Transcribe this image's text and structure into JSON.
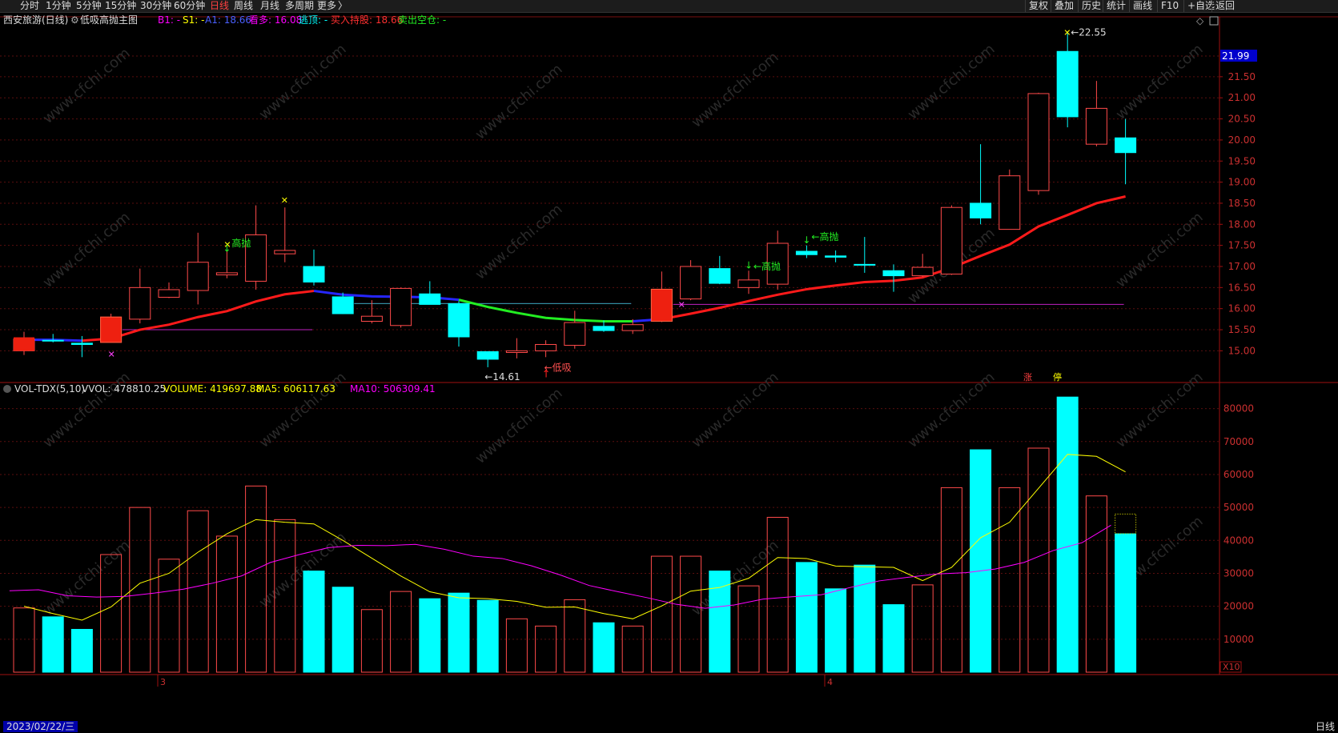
{
  "toolbar": {
    "periods": [
      "分时",
      "1分钟",
      "5分钟",
      "15分钟",
      "30分钟",
      "60分钟",
      "日线",
      "周线",
      "月线",
      "多周期",
      "更多"
    ],
    "active": "日线",
    "right": [
      "复权",
      "叠加",
      "历史",
      "统计",
      "画线",
      "F10",
      "+自选",
      "返回"
    ]
  },
  "header": {
    "stock": "西安旅游(日线)",
    "indicator": "低吸高抛主图",
    "b1": "B1: -",
    "s1": "S1: -",
    "a1": "A1: 18.66",
    "kanduo": "看多: 16.08",
    "taoding": "逃顶: -",
    "mairu": "买入持股: 18.66",
    "maichu": "卖出空仓: -"
  },
  "vol_header": {
    "name": "VOL-TDX(5,10)",
    "vvol": "VVOL: 478810.25",
    "volume": "VOLUME: 419697.88",
    "ma5": "MA5: 606117.63",
    "ma10": "MA10: 506309.41"
  },
  "price_axis": {
    "ticks": [
      "21.50",
      "21.00",
      "20.50",
      "20.00",
      "19.50",
      "19.00",
      "18.50",
      "18.00",
      "17.50",
      "17.00",
      "16.50",
      "16.00",
      "15.50",
      "15.00"
    ],
    "current": "21.99"
  },
  "vol_axis": {
    "ticks": [
      "80000",
      "70000",
      "60000",
      "50000",
      "40000",
      "30000",
      "20000",
      "10000"
    ],
    "unit": "X10"
  },
  "annotations": {
    "high": "22.55",
    "low": "14.61",
    "gaopao": "高抛",
    "dixi": "低吸",
    "zhang": "涨",
    "ting": "停"
  },
  "date_label": "2023/02/22/三",
  "month_labels": [
    "3",
    "4"
  ],
  "period_label": "日线",
  "watermark": "www.cfchi.com",
  "colors": {
    "up": "#ff4a4a",
    "down": "#00ffff",
    "ma_red": "#ff1a1a",
    "ma_blue": "#2626ff",
    "ma_green": "#22ee22",
    "vol_ma5": "#ffff00",
    "vol_ma10": "#ff00ff",
    "hline": "#c020c0"
  },
  "chart_data": {
    "type": "candlestick",
    "candles": [
      {
        "o": 15.0,
        "h": 15.45,
        "l": 14.9,
        "c": 15.28,
        "v": 195000
      },
      {
        "o": 15.25,
        "h": 15.4,
        "l": 15.2,
        "c": 15.23,
        "v": 168000
      },
      {
        "o": 15.18,
        "h": 15.35,
        "l": 14.85,
        "c": 15.15,
        "v": 130000
      },
      {
        "o": 15.2,
        "h": 15.88,
        "l": 15.2,
        "c": 15.8,
        "v": 357000
      },
      {
        "o": 15.75,
        "h": 16.95,
        "l": 15.65,
        "c": 16.5,
        "v": 500000
      },
      {
        "o": 16.27,
        "h": 16.62,
        "l": 16.25,
        "c": 16.45,
        "v": 343000
      },
      {
        "o": 16.43,
        "h": 17.8,
        "l": 16.1,
        "c": 17.1,
        "v": 490000
      },
      {
        "o": 16.8,
        "h": 17.4,
        "l": 16.72,
        "c": 16.85,
        "v": 413000
      },
      {
        "o": 16.65,
        "h": 18.45,
        "l": 16.45,
        "c": 17.75,
        "v": 565000
      },
      {
        "o": 17.3,
        "h": 18.4,
        "l": 17.1,
        "c": 17.38,
        "v": 463000
      },
      {
        "o": 17.0,
        "h": 17.4,
        "l": 16.55,
        "c": 16.63,
        "v": 307000
      },
      {
        "o": 16.28,
        "h": 16.38,
        "l": 15.87,
        "c": 15.88,
        "v": 258000
      },
      {
        "o": 15.7,
        "h": 16.2,
        "l": 15.65,
        "c": 15.82,
        "v": 190000
      },
      {
        "o": 15.6,
        "h": 16.5,
        "l": 15.55,
        "c": 16.48,
        "v": 245000
      },
      {
        "o": 16.35,
        "h": 16.65,
        "l": 16.1,
        "c": 16.1,
        "v": 223000
      },
      {
        "o": 16.12,
        "h": 16.18,
        "l": 15.1,
        "c": 15.33,
        "v": 240000
      },
      {
        "o": 14.98,
        "h": 14.98,
        "l": 14.61,
        "c": 14.8,
        "v": 218000
      },
      {
        "o": 14.96,
        "h": 15.3,
        "l": 14.82,
        "c": 15.0,
        "v": 162000
      },
      {
        "o": 15.0,
        "h": 15.25,
        "l": 14.85,
        "c": 15.15,
        "v": 140000
      },
      {
        "o": 15.13,
        "h": 15.95,
        "l": 15.05,
        "c": 15.67,
        "v": 220000
      },
      {
        "o": 15.58,
        "h": 15.72,
        "l": 15.45,
        "c": 15.48,
        "v": 150000
      },
      {
        "o": 15.48,
        "h": 15.75,
        "l": 15.4,
        "c": 15.62,
        "v": 140000
      },
      {
        "o": 15.7,
        "h": 16.88,
        "l": 15.68,
        "c": 16.46,
        "v": 352000
      },
      {
        "o": 16.23,
        "h": 17.15,
        "l": 16.2,
        "c": 17.0,
        "v": 352000
      },
      {
        "o": 16.95,
        "h": 17.25,
        "l": 16.58,
        "c": 16.6,
        "v": 307000
      },
      {
        "o": 16.5,
        "h": 16.9,
        "l": 16.35,
        "c": 16.68,
        "v": 262000
      },
      {
        "o": 16.58,
        "h": 17.85,
        "l": 16.45,
        "c": 17.55,
        "v": 470000
      },
      {
        "o": 17.36,
        "h": 17.5,
        "l": 17.2,
        "c": 17.28,
        "v": 333000
      },
      {
        "o": 17.25,
        "h": 17.38,
        "l": 17.1,
        "c": 17.22,
        "v": 253000
      },
      {
        "o": 17.05,
        "h": 17.7,
        "l": 16.85,
        "c": 17.03,
        "v": 325000
      },
      {
        "o": 16.9,
        "h": 17.05,
        "l": 16.4,
        "c": 16.78,
        "v": 205000
      },
      {
        "o": 16.78,
        "h": 17.3,
        "l": 16.75,
        "c": 16.98,
        "v": 265000
      },
      {
        "o": 16.82,
        "h": 18.45,
        "l": 16.8,
        "c": 18.4,
        "v": 560000
      },
      {
        "o": 18.5,
        "h": 19.9,
        "l": 18.0,
        "c": 18.15,
        "v": 675000
      },
      {
        "o": 17.88,
        "h": 19.3,
        "l": 17.88,
        "c": 19.15,
        "v": 560000
      },
      {
        "o": 18.8,
        "h": 21.12,
        "l": 18.7,
        "c": 21.1,
        "v": 680000
      },
      {
        "o": 22.1,
        "h": 22.55,
        "l": 20.3,
        "c": 20.55,
        "v": 835000
      },
      {
        "o": 19.9,
        "h": 21.4,
        "l": 19.85,
        "c": 20.75,
        "v": 535000
      },
      {
        "o": 20.05,
        "h": 20.5,
        "l": 18.95,
        "c": 19.7,
        "v": 420000
      }
    ],
    "price_ma": [
      15.26,
      15.26,
      15.24,
      15.29,
      15.5,
      15.62,
      15.8,
      15.94,
      16.17,
      16.34,
      16.42,
      16.33,
      16.29,
      16.28,
      16.27,
      16.21,
      16.04,
      15.9,
      15.78,
      15.73,
      15.7,
      15.7,
      15.75,
      15.88,
      16.02,
      16.18,
      16.33,
      16.46,
      16.55,
      16.63,
      16.66,
      16.74,
      16.97,
      17.25,
      17.52,
      17.95,
      18.22,
      18.5,
      18.66
    ],
    "ma_segments": [
      {
        "from": 0,
        "to": 0,
        "c": "red"
      },
      {
        "from": 0,
        "to": 2,
        "c": "blue"
      },
      {
        "from": 2,
        "to": 10,
        "c": "red"
      },
      {
        "from": 10,
        "to": 15,
        "c": "blue"
      },
      {
        "from": 15,
        "to": 21,
        "c": "green"
      },
      {
        "from": 21,
        "to": 22,
        "c": "blue"
      },
      {
        "from": 22,
        "to": 38,
        "c": "red"
      }
    ],
    "vol_ma5": [
      200000,
      178000,
      158000,
      198000,
      270000,
      300000,
      364000,
      420000,
      463000,
      455000,
      450000,
      400000,
      346000,
      292000,
      244000,
      226000,
      223000,
      215000,
      197000,
      198000,
      178000,
      162000,
      201000,
      246000,
      257000,
      285000,
      348000,
      345000,
      322000,
      320000,
      318000,
      278000,
      318000,
      408000,
      455000,
      558000,
      661000,
      655000,
      608000
    ],
    "vol_ma10": [
      247000,
      250000,
      232000,
      228000,
      230000,
      240000,
      252000,
      270000,
      292000,
      333000,
      357000,
      378000,
      385000,
      384000,
      388000,
      373000,
      352000,
      345000,
      323000,
      295000,
      263000,
      244000,
      226000,
      206000,
      194000,
      204000,
      222000,
      229000,
      235000,
      257000,
      277000,
      288000,
      298000,
      302000,
      313000,
      333000,
      369000,
      393000,
      446000,
      480000,
      496000,
      506000
    ],
    "hlines": [
      {
        "y": 15.5,
        "from": 4,
        "to": 10
      },
      {
        "y": 16.12,
        "from": 12,
        "to": 21
      },
      {
        "y": 16.1,
        "from": 23,
        "to": 38
      }
    ],
    "price_range": [
      14.4,
      22.75
    ],
    "vol_range": [
      0,
      850000
    ]
  }
}
